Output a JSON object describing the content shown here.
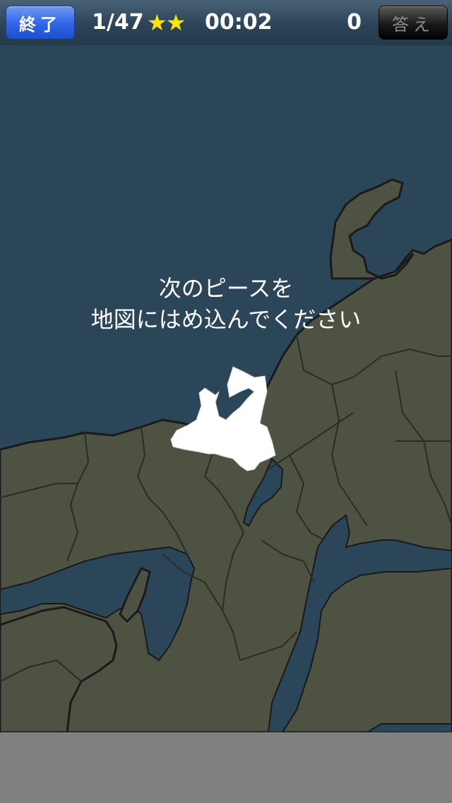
{
  "topbar": {
    "end_label": "終了",
    "progress": "1/47",
    "stars": "★★",
    "timer": "00:02",
    "score": "0",
    "answer_label": "答え"
  },
  "instruction": {
    "line1": "次のピースを",
    "line2": "地図にはめ込んでください"
  },
  "colors": {
    "sea": "#2b4559",
    "land": "#4d5242",
    "border": "#1a1a1a",
    "piece": "#ffffff",
    "star": "#ffe600"
  }
}
